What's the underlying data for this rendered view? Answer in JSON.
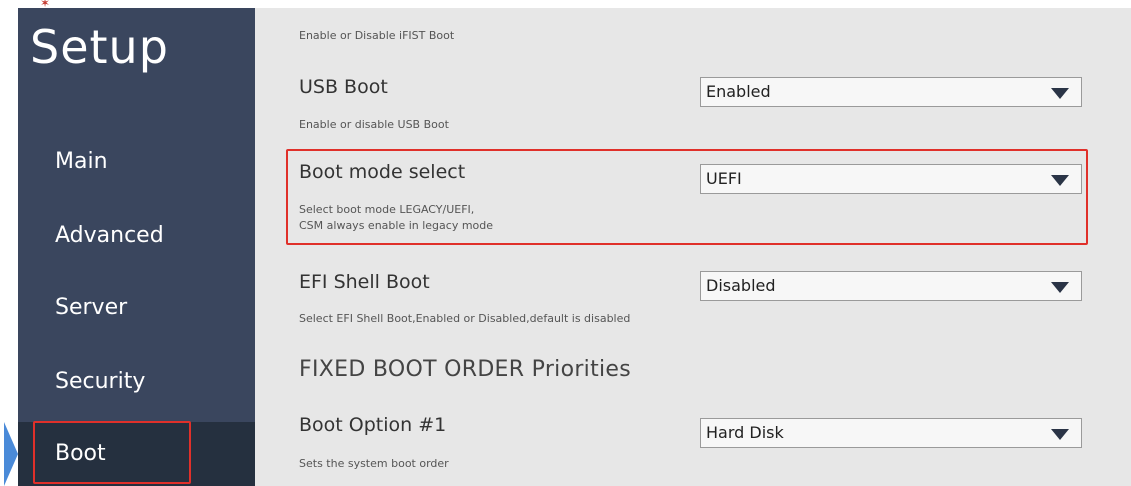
{
  "sidebar": {
    "title": "Setup",
    "items": [
      {
        "label": "Main"
      },
      {
        "label": "Advanced"
      },
      {
        "label": "Server"
      },
      {
        "label": "Security"
      },
      {
        "label": "Boot",
        "active": true
      }
    ]
  },
  "content": {
    "top_help": "Enable or Disable iFIST Boot",
    "settings": [
      {
        "label": "USB Boot",
        "value": "Enabled",
        "help": "Enable or disable USB Boot"
      },
      {
        "label": "Boot mode select",
        "value": "UEFI",
        "help_line1": "Select boot mode LEGACY/UEFI,",
        "help_line2": "CSM always enable in legacy mode",
        "highlighted": true
      },
      {
        "label": "EFI Shell Boot",
        "value": "Disabled",
        "help": "Select EFI Shell Boot,Enabled or Disabled,default is disabled"
      }
    ],
    "section_heading": "FIXED BOOT ORDER Priorities",
    "boot_options": [
      {
        "label": "Boot Option #1",
        "value": "Hard Disk",
        "help": "Sets the system boot order"
      }
    ]
  },
  "colors": {
    "sidebar_bg": "#3a465e",
    "sidebar_active_bg": "#25303f",
    "content_bg": "#e7e7e7",
    "highlight_border": "#e0302a",
    "pointer_accent": "#4a8ad8",
    "dropdown_arrow": "#2a3446"
  },
  "icons": {
    "dropdown": "triangle-down-icon",
    "nav_pointer": "active-pointer-icon"
  }
}
